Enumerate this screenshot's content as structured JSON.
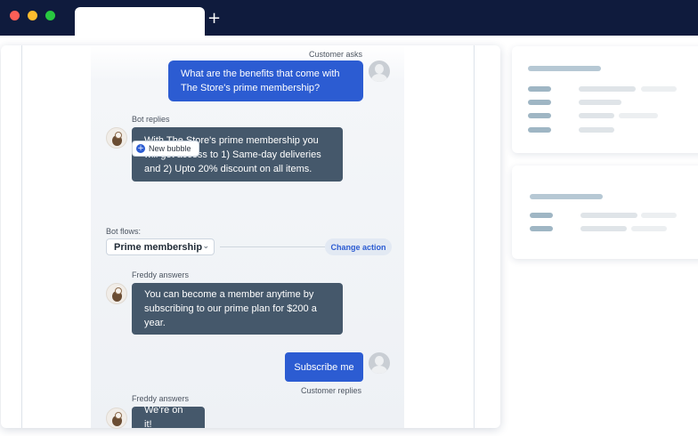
{
  "browser": {
    "new_tab_symbol": "+"
  },
  "chat": {
    "customer_question_label": "Customer asks",
    "customer_question_lines": [
      "What are the benefits that come with",
      "The Store's prime membership?"
    ],
    "bot_reply_label": "Bot replies",
    "bot_reply_lines": [
      "With The Store's prime membership you",
      "will get access to 1) Same-day deliveries",
      "and 2) Upto 20% discount on all items."
    ],
    "new_bubble_label": "New bubble",
    "bot_flows_label": "Bot flows:",
    "flow_select_value": "Prime membership",
    "change_action_label": "Change action",
    "freddy_label_1": "Freddy answers",
    "freddy_answer_lines": [
      "You can become a member anytime by",
      "subscribing to our prime plan for $200 a",
      "year."
    ],
    "customer_reply_text": "Subscribe me",
    "customer_reply_label": "Customer replies",
    "freddy_label_2": "Freddy answers",
    "freddy_answer_2": "We're on it!"
  },
  "colors": {
    "titlebar": "#0f1b3d",
    "customer_bubble": "#2c5cd2",
    "bot_bubble": "#45586b",
    "traffic_red": "#ff5f57",
    "traffic_yellow": "#febc2e",
    "traffic_green": "#28c840"
  }
}
